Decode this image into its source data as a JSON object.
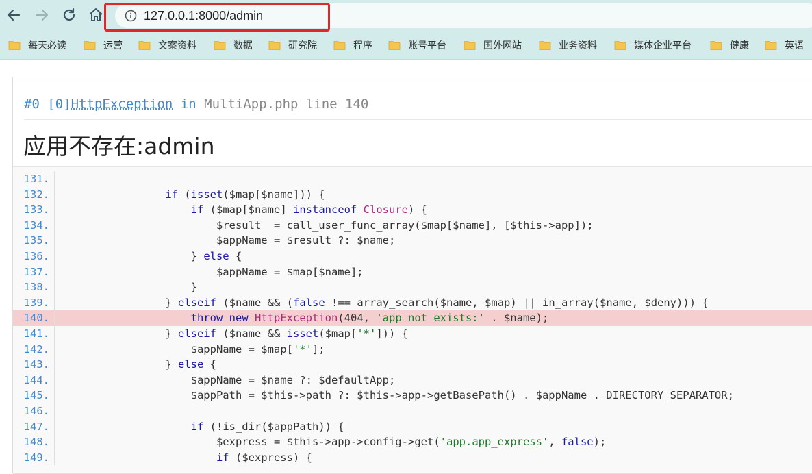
{
  "browser": {
    "url": "127.0.0.1:8000/admin",
    "bookmarks": [
      {
        "label": "每天必读"
      },
      {
        "label": "运营"
      },
      {
        "label": "文案资料"
      },
      {
        "label": "数据"
      },
      {
        "label": "研究院"
      },
      {
        "label": "程序"
      },
      {
        "label": "账号平台"
      },
      {
        "label": "国外网站"
      },
      {
        "label": "业务资料"
      },
      {
        "label": "媒体企业平台"
      },
      {
        "label": "健康"
      },
      {
        "label": "英语"
      }
    ],
    "colors": {
      "toolbar": "#d4ebeb",
      "highlight_box": "#e02828"
    }
  },
  "error": {
    "index": "#0 [0]",
    "exception": "HttpException",
    "in_word": " in ",
    "file": "MultiApp.php line 140",
    "message": "应用不存在:admin"
  },
  "code": {
    "highlight_line": "140.",
    "lines": [
      {
        "no": "131.",
        "text": ""
      },
      {
        "no": "132.",
        "text": "                if (isset($map[$name])) {"
      },
      {
        "no": "133.",
        "text": "                    if ($map[$name] instanceof Closure) {"
      },
      {
        "no": "134.",
        "text": "                        $result  = call_user_func_array($map[$name], [$this->app]);"
      },
      {
        "no": "135.",
        "text": "                        $appName = $result ?: $name;"
      },
      {
        "no": "136.",
        "text": "                    } else {"
      },
      {
        "no": "137.",
        "text": "                        $appName = $map[$name];"
      },
      {
        "no": "138.",
        "text": "                    }"
      },
      {
        "no": "139.",
        "text": "                } elseif ($name && (false !== array_search($name, $map) || in_array($name, $deny))) {"
      },
      {
        "no": "140.",
        "text": "                    throw new HttpException(404, 'app not exists:' . $name);"
      },
      {
        "no": "141.",
        "text": "                } elseif ($name && isset($map['*'])) {"
      },
      {
        "no": "142.",
        "text": "                    $appName = $map['*'];"
      },
      {
        "no": "143.",
        "text": "                } else {"
      },
      {
        "no": "144.",
        "text": "                    $appName = $name ?: $defaultApp;"
      },
      {
        "no": "145.",
        "text": "                    $appPath = $this->path ?: $this->app->getBasePath() . $appName . DIRECTORY_SEPARATOR;"
      },
      {
        "no": "146.",
        "text": ""
      },
      {
        "no": "147.",
        "text": "                    if (!is_dir($appPath)) {"
      },
      {
        "no": "148.",
        "text": "                        $express = $this->app->config->get('app.app_express', false);"
      },
      {
        "no": "149.",
        "text": "                        if ($express) {"
      }
    ]
  }
}
